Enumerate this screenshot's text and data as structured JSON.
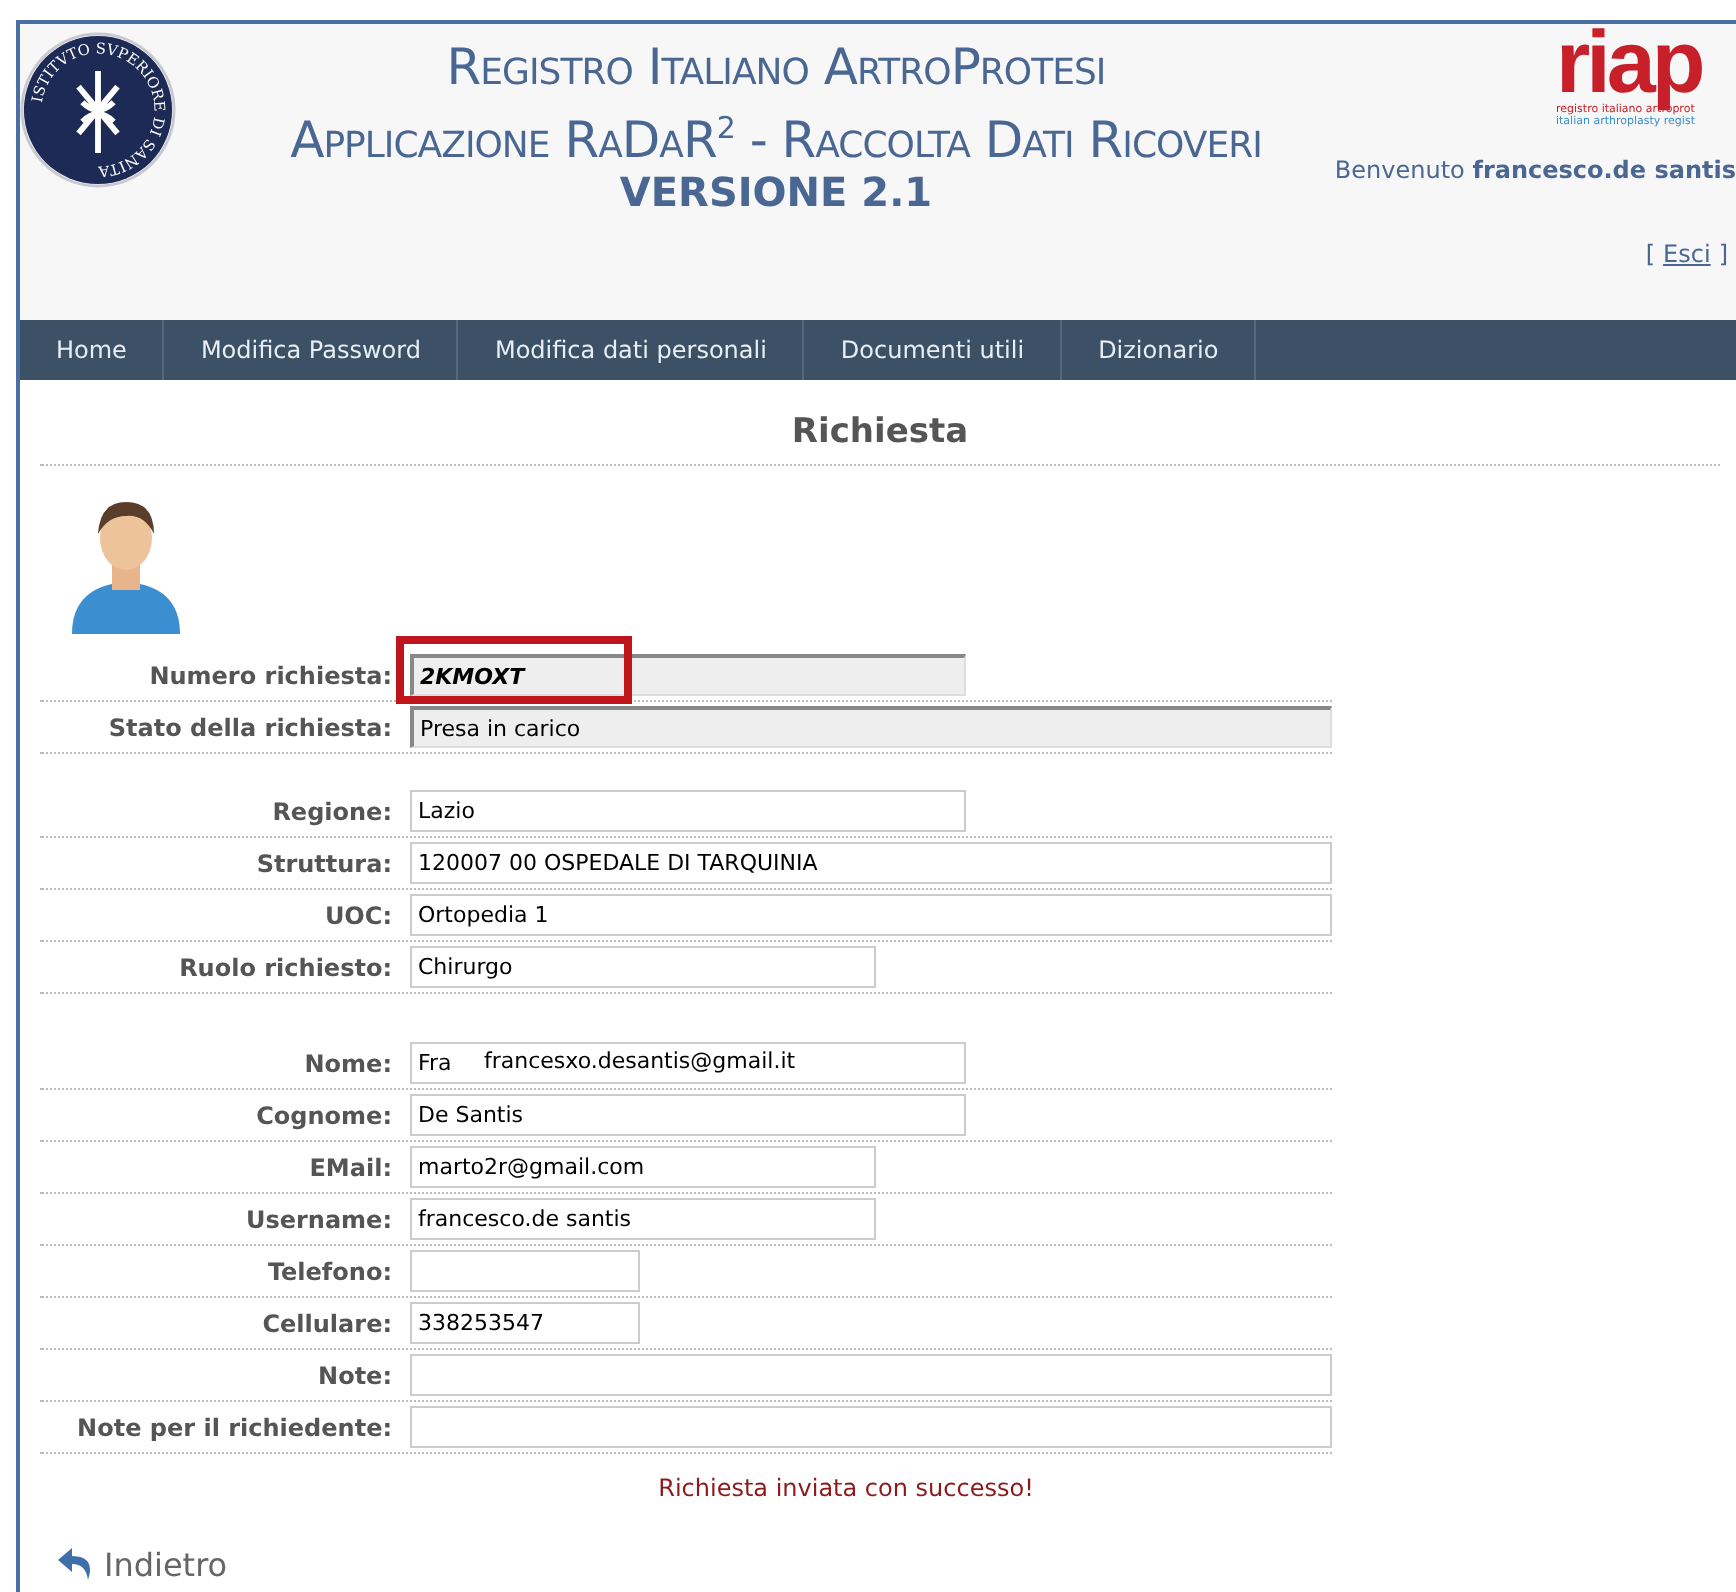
{
  "header": {
    "seal_text": "ISTITVTO SVPERIORE DI SANITA",
    "title_lines": [
      "Registro Italiano ArtroProtesi",
      "Applicazione RaDaR$^{2}$ - Raccolta Dati Ricoveri"
    ],
    "version": "VERSIONE 2.1",
    "logo": {
      "mark": "riap",
      "line_1": "registro italiano artroprot",
      "line_2": "italian arthroplasty regist"
    },
    "welcome": "Benvenuto",
    "user": "francesco.de santis",
    "logout": {
      "open": "[",
      "link": "Esci",
      "close": "]"
    }
  },
  "nav": [
    {
      "label": "Home"
    },
    {
      "label": "Modifica Password"
    },
    {
      "label": "Modifica dati personali"
    },
    {
      "label": "Documenti utili"
    },
    {
      "label": "Dizionario"
    }
  ],
  "page_title": "Richiesta",
  "sections": [
    {
      "fields": [
        {
          "label": "Numero richiesta:",
          "value": "2KMOXT",
          "kind": "readonly",
          "highlighted": true
        },
        {
          "label": "Stato della richiesta:",
          "value": "Presa in carico",
          "kind": "readonly",
          "highlighted": false
        }
      ]
    },
    {
      "fields": [
        {
          "label": "Regione:",
          "value": "Lazio",
          "kind": "text",
          "highlighted": false
        },
        {
          "label": "Struttura:",
          "value": "120007 00 OSPEDALE DI TARQUINIA",
          "kind": "text",
          "highlighted": false
        },
        {
          "label": "UOC:",
          "value": "Ortopedia 1",
          "kind": "text",
          "highlighted": false
        },
        {
          "label": "Ruolo richiesto:",
          "value": "Chirurgo",
          "kind": "text",
          "highlighted": false
        }
      ]
    },
    {
      "fields": [
        {
          "label": "Nome:",
          "value": "Fra",
          "kind": "text",
          "highlighted": false,
          "autocomplete": "francesxo.desantis@gmail.it"
        },
        {
          "label": "Cognome:",
          "value": "De Santis",
          "kind": "text",
          "highlighted": false
        },
        {
          "label": "EMail:",
          "value": "marto2r@gmail.com",
          "kind": "text",
          "highlighted": false
        },
        {
          "label": "Username:",
          "value": "francesco.de santis",
          "kind": "text",
          "highlighted": false
        },
        {
          "label": "Telefono:",
          "kind": "text",
          "highlighted": false
        },
        {
          "label": "Cellulare:",
          "value": "338253547",
          "kind": "text",
          "highlighted": false
        },
        {
          "label": "Note:",
          "kind": "text",
          "highlighted": false
        },
        {
          "label": "Note per il richiedente:",
          "kind": "text",
          "highlighted": false
        }
      ]
    }
  ],
  "message": "Richiesta inviata con successo!",
  "back": "Indietro"
}
